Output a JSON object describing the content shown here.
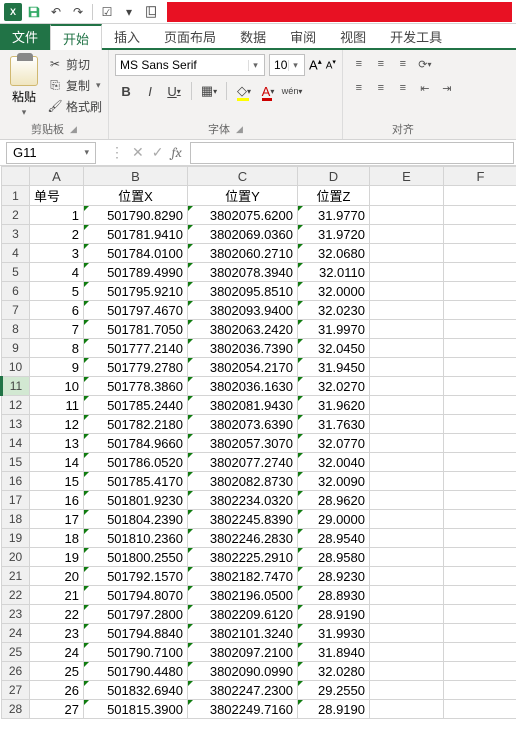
{
  "qat": {
    "app": "X▮",
    "save": "💾",
    "undo": "↶",
    "redo": "↷",
    "touch": "☝",
    "customize": "▾"
  },
  "tabs": {
    "file": "文件",
    "home": "开始",
    "insert": "插入",
    "layout": "页面布局",
    "data": "数据",
    "review": "审阅",
    "view": "视图",
    "dev": "开发工具"
  },
  "ribbon": {
    "clipboard": {
      "paste": "粘贴",
      "cut": "剪切",
      "copy": "复制",
      "format_painter": "格式刷",
      "group": "剪贴板"
    },
    "font": {
      "name": "MS Sans Serif",
      "size": "10",
      "group": "字体",
      "bold": "B",
      "italic": "I",
      "underline": "U",
      "inc": "A",
      "dec": "A"
    },
    "align": {
      "group": "对齐"
    }
  },
  "fx": {
    "cell_ref": "G11",
    "fx_label": "fx"
  },
  "sheet": {
    "cols": [
      "A",
      "B",
      "C",
      "D",
      "E",
      "F"
    ],
    "headers": {
      "A": "单号",
      "B": "位置X",
      "C": "位置Y",
      "D": "位置Z"
    },
    "rows": [
      {
        "n": 1,
        "a": "1",
        "b": "501790.8290",
        "c": "3802075.6200",
        "d": "31.9770"
      },
      {
        "n": 2,
        "a": "2",
        "b": "501781.9410",
        "c": "3802069.0360",
        "d": "31.9720"
      },
      {
        "n": 3,
        "a": "3",
        "b": "501784.0100",
        "c": "3802060.2710",
        "d": "32.0680"
      },
      {
        "n": 4,
        "a": "4",
        "b": "501789.4990",
        "c": "3802078.3940",
        "d": "32.0110"
      },
      {
        "n": 5,
        "a": "5",
        "b": "501795.9210",
        "c": "3802095.8510",
        "d": "32.0000"
      },
      {
        "n": 6,
        "a": "6",
        "b": "501797.4670",
        "c": "3802093.9400",
        "d": "32.0230"
      },
      {
        "n": 7,
        "a": "7",
        "b": "501781.7050",
        "c": "3802063.2420",
        "d": "31.9970"
      },
      {
        "n": 8,
        "a": "8",
        "b": "501777.2140",
        "c": "3802036.7390",
        "d": "32.0450"
      },
      {
        "n": 9,
        "a": "9",
        "b": "501779.2780",
        "c": "3802054.2170",
        "d": "31.9450"
      },
      {
        "n": 10,
        "a": "10",
        "b": "501778.3860",
        "c": "3802036.1630",
        "d": "32.0270"
      },
      {
        "n": 11,
        "a": "11",
        "b": "501785.2440",
        "c": "3802081.9430",
        "d": "31.9620"
      },
      {
        "n": 12,
        "a": "12",
        "b": "501782.2180",
        "c": "3802073.6390",
        "d": "31.7630"
      },
      {
        "n": 13,
        "a": "13",
        "b": "501784.9660",
        "c": "3802057.3070",
        "d": "32.0770"
      },
      {
        "n": 14,
        "a": "14",
        "b": "501786.0520",
        "c": "3802077.2740",
        "d": "32.0040"
      },
      {
        "n": 15,
        "a": "15",
        "b": "501785.4170",
        "c": "3802082.8730",
        "d": "32.0090"
      },
      {
        "n": 16,
        "a": "16",
        "b": "501801.9230",
        "c": "3802234.0320",
        "d": "28.9620"
      },
      {
        "n": 17,
        "a": "17",
        "b": "501804.2390",
        "c": "3802245.8390",
        "d": "29.0000"
      },
      {
        "n": 18,
        "a": "18",
        "b": "501810.2360",
        "c": "3802246.2830",
        "d": "28.9540"
      },
      {
        "n": 19,
        "a": "19",
        "b": "501800.2550",
        "c": "3802225.2910",
        "d": "28.9580"
      },
      {
        "n": 20,
        "a": "20",
        "b": "501792.1570",
        "c": "3802182.7470",
        "d": "28.9230"
      },
      {
        "n": 21,
        "a": "21",
        "b": "501794.8070",
        "c": "3802196.0500",
        "d": "28.8930"
      },
      {
        "n": 22,
        "a": "22",
        "b": "501797.2800",
        "c": "3802209.6120",
        "d": "28.9190"
      },
      {
        "n": 23,
        "a": "23",
        "b": "501794.8840",
        "c": "3802101.3240",
        "d": "31.9930"
      },
      {
        "n": 24,
        "a": "24",
        "b": "501790.7100",
        "c": "3802097.2100",
        "d": "31.8940"
      },
      {
        "n": 25,
        "a": "25",
        "b": "501790.4480",
        "c": "3802090.0990",
        "d": "32.0280"
      },
      {
        "n": 26,
        "a": "26",
        "b": "501832.6940",
        "c": "3802247.2300",
        "d": "29.2550"
      },
      {
        "n": 27,
        "a": "27",
        "b": "501815.3900",
        "c": "3802249.7160",
        "d": "28.9190"
      }
    ],
    "selected_row": 11
  }
}
